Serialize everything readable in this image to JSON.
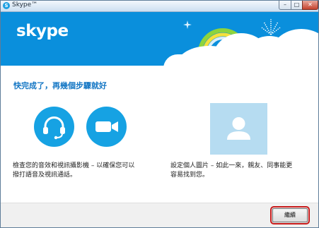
{
  "window": {
    "title": "Skype™",
    "minimize": "–",
    "maximize": "□",
    "close": "✕"
  },
  "banner": {
    "logo": "skype"
  },
  "main": {
    "heading": "快完成了，再幾個步驟就好",
    "av_description_line1": "檢查您的音效和視訊攝影機 – 以確保您可以",
    "av_description_line2": "撥打語音及視訊通話。",
    "picture_description_line1": "設定個人圖片 – 如此一來，親友、同事能更",
    "picture_description_line2": "容易找到您。"
  },
  "footer": {
    "continue_label": "繼續"
  },
  "colors": {
    "banner_blue": "#0a8fdc",
    "icon_blue": "#16a2e3",
    "heading_blue": "#1376c4",
    "highlight_red": "#c61a1a"
  }
}
